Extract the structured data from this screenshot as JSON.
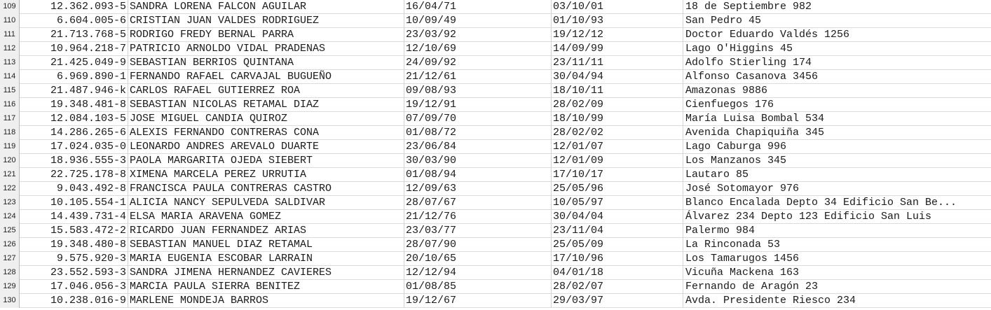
{
  "sheet": {
    "rows": [
      {
        "num": "109",
        "rut": "12.362.093-5",
        "name": "SANDRA LORENA FALCON AGUILAR",
        "date1": "16/04/71",
        "date2": "03/10/01",
        "address": "18 de Septiembre 982"
      },
      {
        "num": "110",
        "rut": "6.604.005-6",
        "name": "CRISTIAN JUAN VALDES RODRIGUEZ",
        "date1": "10/09/49",
        "date2": "01/10/93",
        "address": "San Pedro 45"
      },
      {
        "num": "111",
        "rut": "21.713.768-5",
        "name": "RODRIGO FREDY BERNAL PARRA",
        "date1": "23/03/92",
        "date2": "19/12/12",
        "address": "Doctor Eduardo Valdés 1256"
      },
      {
        "num": "112",
        "rut": "10.964.218-7",
        "name": "PATRICIO ARNOLDO VIDAL PRADENAS",
        "date1": "12/10/69",
        "date2": "14/09/99",
        "address": "Lago O'Higgins 45"
      },
      {
        "num": "113",
        "rut": "21.425.049-9",
        "name": "SEBASTIAN  BERRIOS QUINTANA",
        "date1": "24/09/92",
        "date2": "23/11/11",
        "address": "Adolfo Stierling 174"
      },
      {
        "num": "114",
        "rut": "6.969.890-1",
        "name": "FERNANDO RAFAEL CARVAJAL BUGUEÑO",
        "date1": "21/12/61",
        "date2": "30/04/94",
        "address": "Alfonso Casanova 3456"
      },
      {
        "num": "115",
        "rut": "21.487.946-k",
        "name": "CARLOS RAFAEL GUTIERREZ ROA",
        "date1": "09/08/93",
        "date2": "18/10/11",
        "address": "Amazonas 9886"
      },
      {
        "num": "116",
        "rut": "19.348.481-8",
        "name": "SEBASTIAN NICOLAS RETAMAL DIAZ",
        "date1": "19/12/91",
        "date2": "28/02/09",
        "address": "Cienfuegos 176"
      },
      {
        "num": "117",
        "rut": "12.084.103-5",
        "name": "JOSE MIGUEL CANDIA QUIROZ",
        "date1": "07/09/70",
        "date2": "18/10/99",
        "address": "María Luisa Bombal 534"
      },
      {
        "num": "118",
        "rut": "14.286.265-6",
        "name": "ALEXIS FERNANDO CONTRERAS CONA",
        "date1": "01/08/72",
        "date2": "28/02/02",
        "address": "Avenida Chapiquiña 345"
      },
      {
        "num": "119",
        "rut": "17.024.035-0",
        "name": "LEONARDO ANDRES AREVALO DUARTE",
        "date1": "23/06/84",
        "date2": "12/01/07",
        "address": "Lago Caburga 996"
      },
      {
        "num": "120",
        "rut": "18.936.555-3",
        "name": "PAOLA MARGARITA OJEDA SIEBERT",
        "date1": "30/03/90",
        "date2": "12/01/09",
        "address": "Los Manzanos 345"
      },
      {
        "num": "121",
        "rut": "22.725.178-8",
        "name": "XIMENA MARCELA PEREZ URRUTIA",
        "date1": "01/08/94",
        "date2": "17/10/17",
        "address": "Lautaro 85"
      },
      {
        "num": "122",
        "rut": "9.043.492-8",
        "name": "FRANCISCA PAULA CONTRERAS CASTRO",
        "date1": "12/09/63",
        "date2": "25/05/96",
        "address": "José Sotomayor 976"
      },
      {
        "num": "123",
        "rut": "10.105.554-1",
        "name": "ALICIA NANCY SEPULVEDA SALDIVAR",
        "date1": "28/07/67",
        "date2": "10/05/97",
        "address": "Blanco Encalada Depto 34 Edificio San Be..."
      },
      {
        "num": "124",
        "rut": "14.439.731-4",
        "name": "ELSA MARIA ARAVENA GOMEZ",
        "date1": "21/12/76",
        "date2": "30/04/04",
        "address": "Álvarez 234 Depto 123 Edificio San Luis"
      },
      {
        "num": "125",
        "rut": "15.583.472-2",
        "name": "RICARDO JUAN FERNANDEZ ARIAS",
        "date1": "23/03/77",
        "date2": "23/11/04",
        "address": "Palermo 984"
      },
      {
        "num": "126",
        "rut": "19.348.480-8",
        "name": "SEBASTIAN MANUEL DIAZ RETAMAL",
        "date1": "28/07/90",
        "date2": "25/05/09",
        "address": "La Rinconada 53"
      },
      {
        "num": "127",
        "rut": "9.575.920-3",
        "name": "MARIA EUGENIA ESCOBAR LARRAIN",
        "date1": "20/10/65",
        "date2": "17/10/96",
        "address": "Los Tamarugos 1456"
      },
      {
        "num": "128",
        "rut": "23.552.593-3",
        "name": "SANDRA JIMENA HERNANDEZ CAVIERES",
        "date1": "12/12/94",
        "date2": "04/01/18",
        "address": "Vicuña Mackena 163"
      },
      {
        "num": "129",
        "rut": "17.046.056-3",
        "name": "MARCIA PAULA SIERRA BENITEZ",
        "date1": "01/08/85",
        "date2": "28/02/07",
        "address": "Fernando de Aragón 23"
      },
      {
        "num": "130",
        "rut": "10.238.016-9",
        "name": "MARLENE  MONDEJA BARROS",
        "date1": "19/12/67",
        "date2": "29/03/97",
        "address": "Avda. Presidente Riesco 234"
      }
    ]
  }
}
